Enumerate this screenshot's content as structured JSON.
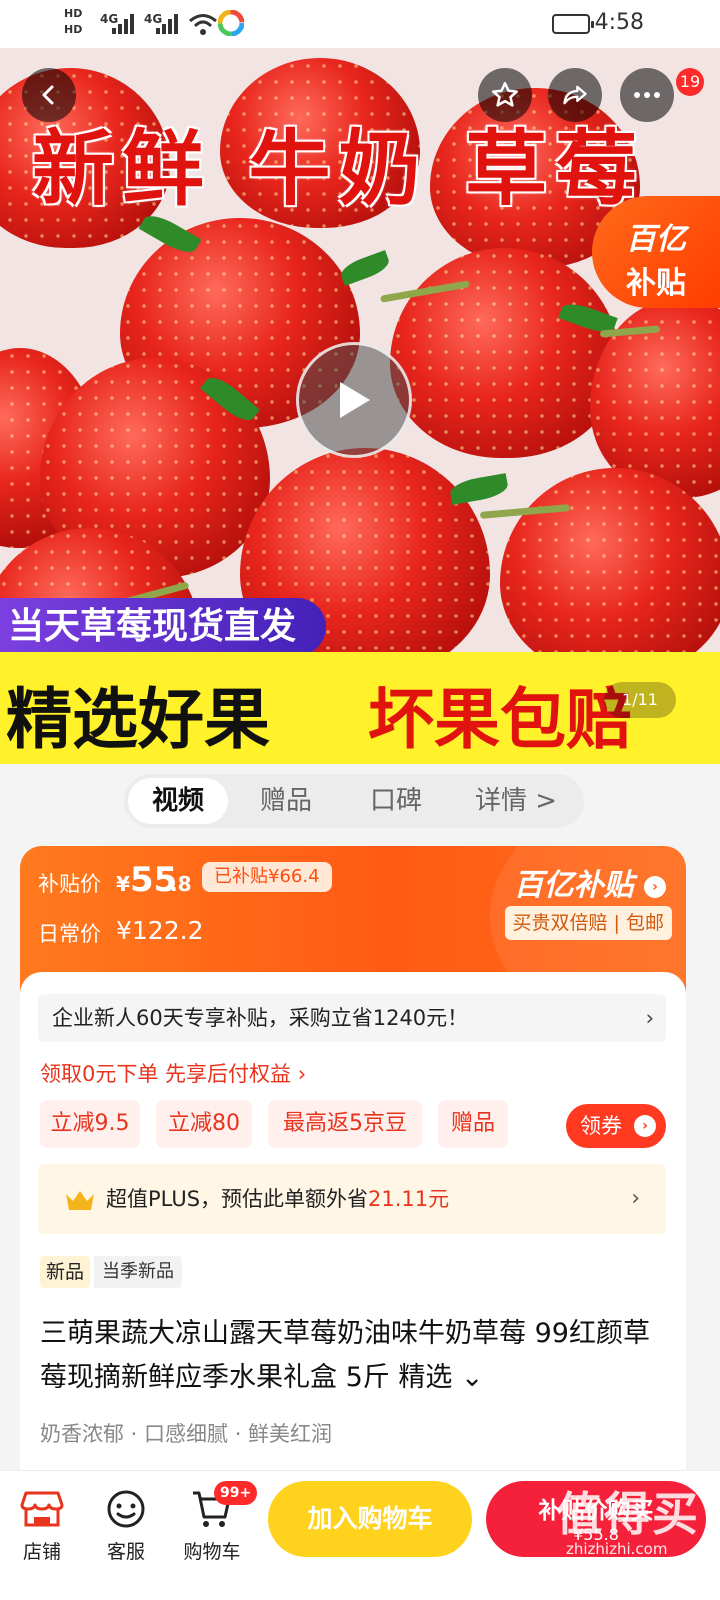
{
  "status_bar": {
    "hd1": "HD",
    "hd2": "HD",
    "net1": "4G",
    "net2": "4G",
    "time": "4:58"
  },
  "hero": {
    "title": "新鲜 牛奶 草莓",
    "subsidy_badge_line1": "百亿",
    "subsidy_badge_line2": "补贴",
    "share_count": "19",
    "banner_top": "当天草莓现货直发",
    "banner_left": "精选好果",
    "banner_right": "坏果包赔",
    "page_indicator": "1/11",
    "icons": [
      "back-icon",
      "star-icon",
      "share-icon",
      "more-icon",
      "play-icon"
    ]
  },
  "tabs": [
    {
      "label": "视频",
      "active": true
    },
    {
      "label": "赠品",
      "active": false
    },
    {
      "label": "口碑",
      "active": false
    },
    {
      "label": "详情 >",
      "active": false
    }
  ],
  "price": {
    "subsidy_label": "补贴价",
    "currency": "¥",
    "subsidy_int": "55",
    "subsidy_dec": ".8",
    "already_subsidized": "已补贴¥66.4",
    "daily_label": "日常价",
    "daily_price": "¥122.2",
    "brand": "百亿补贴",
    "guarantee": "买贵双倍赔 | 包邮"
  },
  "promo": {
    "notice": "企业新人60天专享补贴，采购立省1240元！",
    "pay_later": "领取0元下单 先享后付权益 ›",
    "chips": [
      "立减9.5",
      "立减80",
      "最高返5京豆",
      "赠品"
    ],
    "coupon_button": "领券",
    "plus_prefix": "超值PLUS，预估此单额外省",
    "plus_amount": "21.11元"
  },
  "product": {
    "tag_new": "新品",
    "tag_season": "当季新品",
    "title": "三萌果蔬大凉山露天草莓奶油味牛奶草莓 99红颜草莓现摘新鲜应季水果礼盒 5斤 精选 ⌄",
    "selling_points": "奶香浓郁 · 口感细腻 · 鲜美红润"
  },
  "bottom_bar": {
    "shop": "店铺",
    "service": "客服",
    "cart": "购物车",
    "cart_badge": "99+",
    "add_to_cart": "加入购物车",
    "buy_now": "补贴价购买",
    "buy_price": "¥55.8",
    "watermark": "值得买",
    "watermark_url": "zhizhizhi.com"
  },
  "colors": {
    "accent_red": "#e8341c",
    "subsidy_orange": "#ff5a14",
    "cart_yellow": "#ffd21e",
    "buy_red": "#f5203a"
  }
}
